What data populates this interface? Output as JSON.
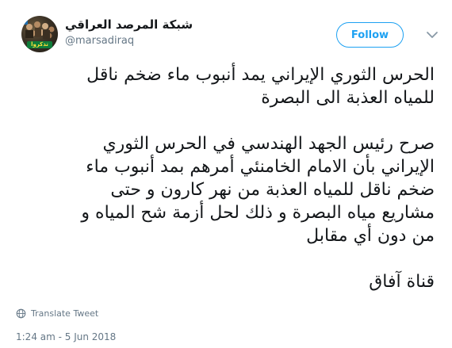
{
  "tweet": {
    "author": {
      "name": "شبكة المرصد العراقي",
      "handle": "@marsadiraq",
      "avatar_tag": "تذكروا"
    },
    "follow_label": "Follow",
    "caret_icon": "chevron-down-icon",
    "paragraphs": [
      "الحرس الثوري الإيراني يمد أنبوب ماء ضخم ناقل\nللمياه العذبة الى البصرة",
      "صرح رئيس الجهد الهندسي في الحرس الثوري\nالإيراني بأن الامام الخامنئي أمرهم بمد أنبوب ماء\nضخم ناقل للمياه العذبة من نهر كارون و حتى\nمشاريع مياه البصرة و ذلك لحل أزمة شح المياه و\nمن دون أي مقابل",
      "قناة آفاق"
    ],
    "translate_label": "Translate Tweet",
    "translate_icon": "globe-icon",
    "timestamp": "1:24 am - 5 Jun 2018"
  },
  "colors": {
    "accent": "#1da1f2",
    "secondary_text": "#657786",
    "primary_text": "#14171a"
  }
}
